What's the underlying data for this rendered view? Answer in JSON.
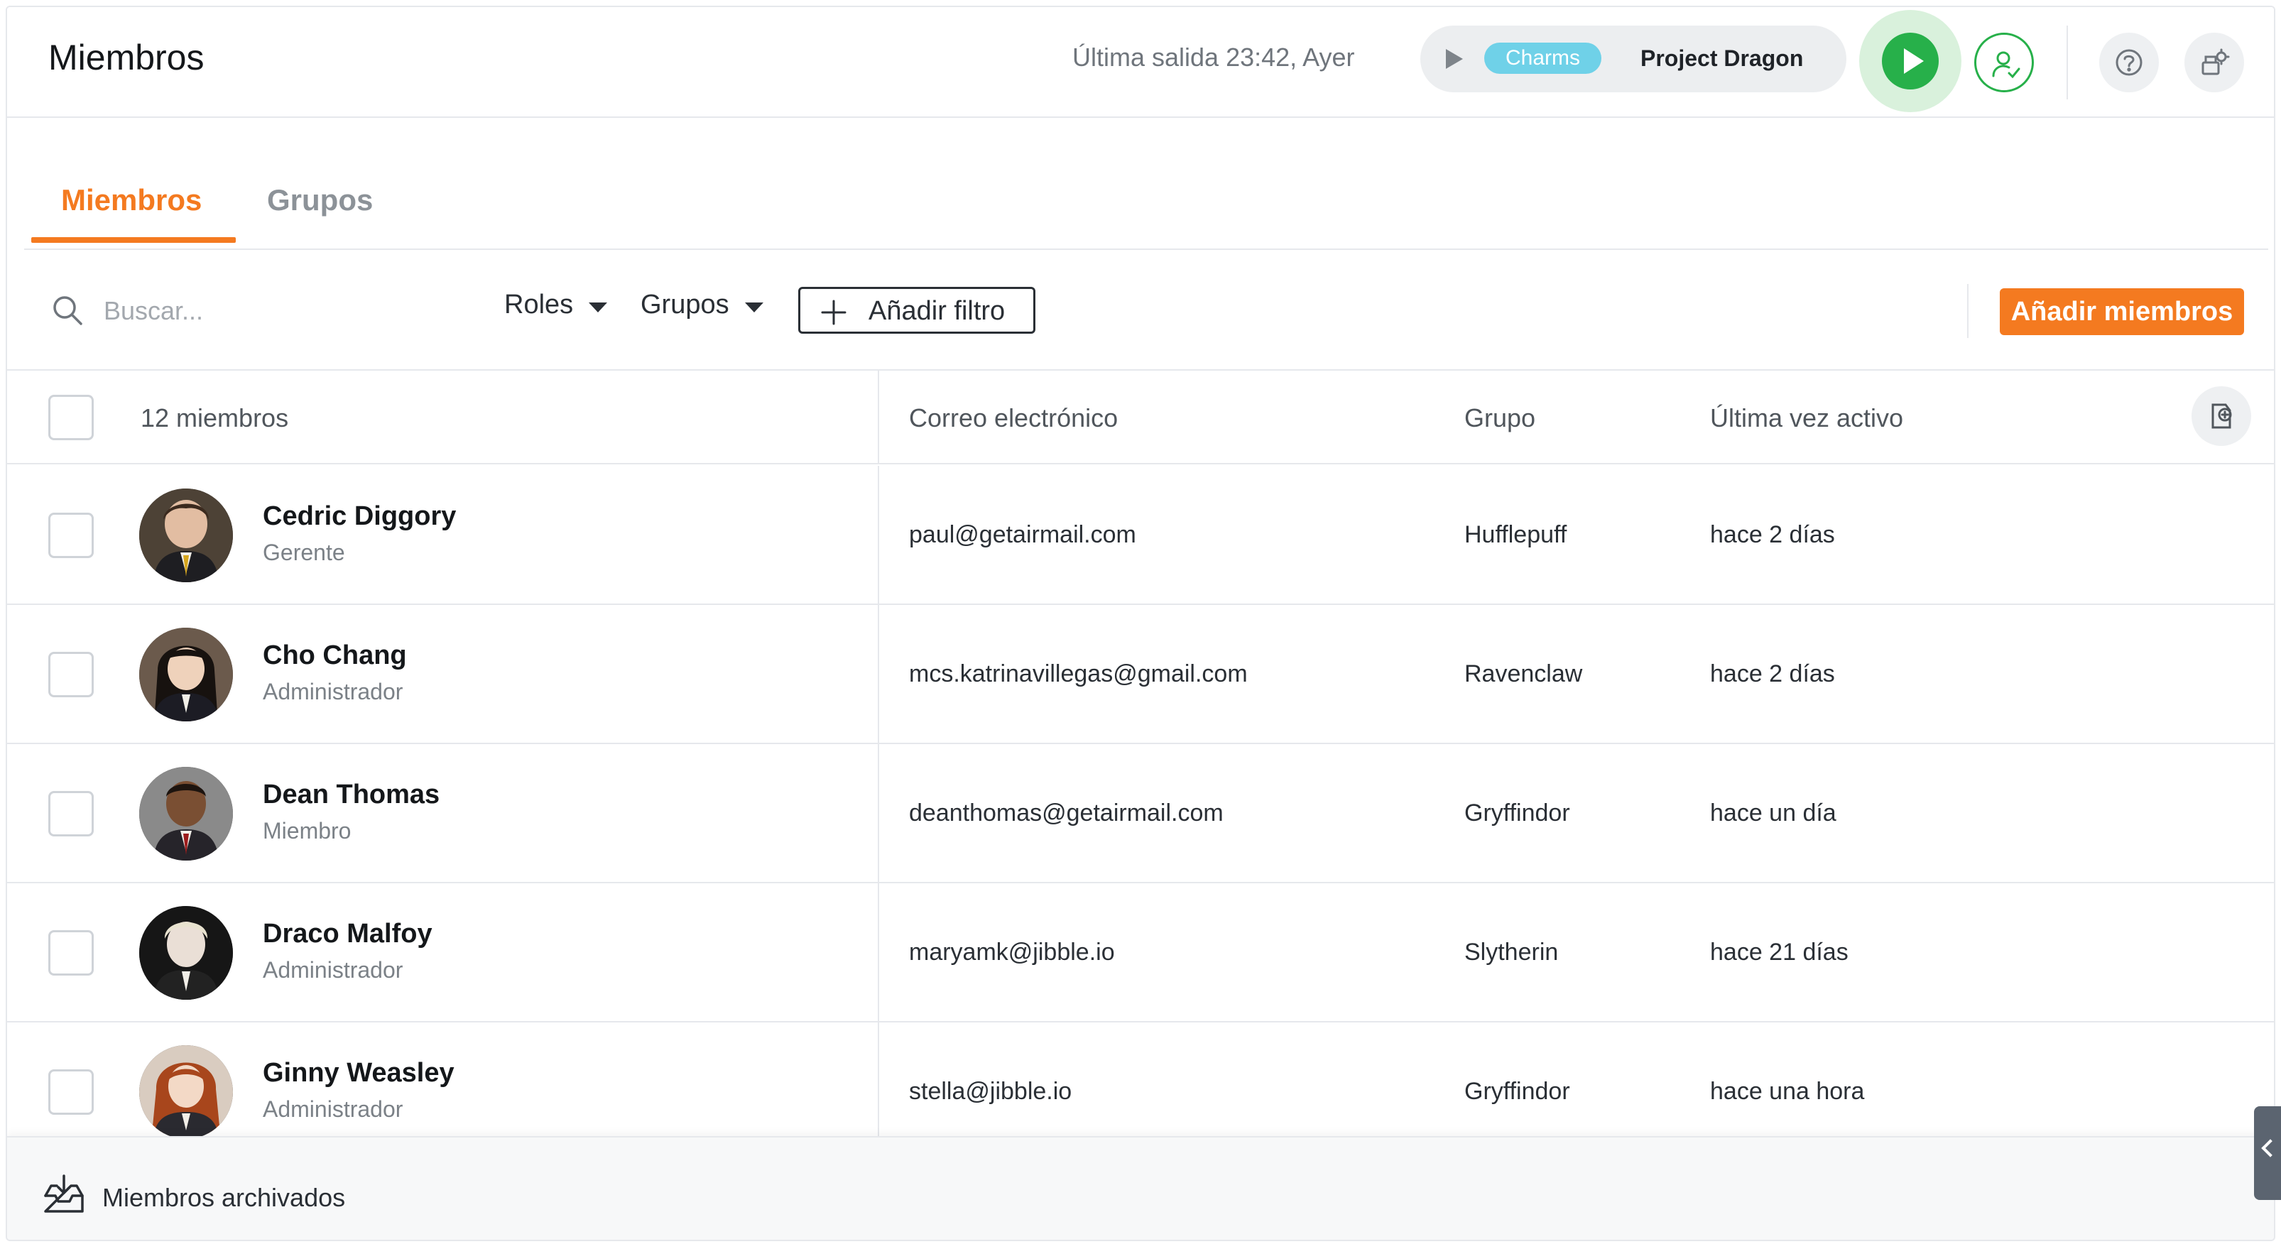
{
  "header": {
    "title": "Miembros",
    "last_out": "Última salida 23:42, Ayer",
    "activity": "Charms",
    "project": "Project Dragon"
  },
  "tabs": [
    {
      "label": "Miembros",
      "active": true
    },
    {
      "label": "Grupos",
      "active": false
    }
  ],
  "toolbar": {
    "search_placeholder": "Buscar...",
    "roles_label": "Roles",
    "groups_label": "Grupos",
    "add_filter_label": "Añadir filtro",
    "add_members_label": "Añadir miembros"
  },
  "table": {
    "count_label": "12 miembros",
    "columns": [
      "Correo electrónico",
      "Grupo",
      "Última vez activo"
    ],
    "rows": [
      {
        "name": "Cedric Diggory",
        "role": "Gerente",
        "email": "paul@getairmail.com",
        "group": "Hufflepuff",
        "last_active": "hace 2 días"
      },
      {
        "name": "Cho Chang",
        "role": "Administrador",
        "email": "mcs.katrinavillegas@gmail.com",
        "group": "Ravenclaw",
        "last_active": "hace 2 días"
      },
      {
        "name": "Dean Thomas",
        "role": "Miembro",
        "email": "deanthomas@getairmail.com",
        "group": "Gryffindor",
        "last_active": "hace un día"
      },
      {
        "name": "Draco Malfoy",
        "role": "Administrador",
        "email": "maryamk@jibble.io",
        "group": "Slytherin",
        "last_active": "hace 21 días"
      },
      {
        "name": "Ginny Weasley",
        "role": "Administrador",
        "email": "stella@jibble.io",
        "group": "Gryffindor",
        "last_active": "hace una hora"
      }
    ]
  },
  "footer": {
    "archived_label": "Miembros archivados"
  },
  "colors": {
    "accent": "#f47a20",
    "play_green": "#27b04a",
    "activity_badge": "#6fd1e8"
  },
  "icons": [
    "search-icon",
    "chevron-down-icon",
    "plus-icon",
    "play-icon",
    "user-check-icon",
    "help-icon",
    "settings-icon",
    "column-settings-icon",
    "archive-icon",
    "chevron-left-icon"
  ]
}
